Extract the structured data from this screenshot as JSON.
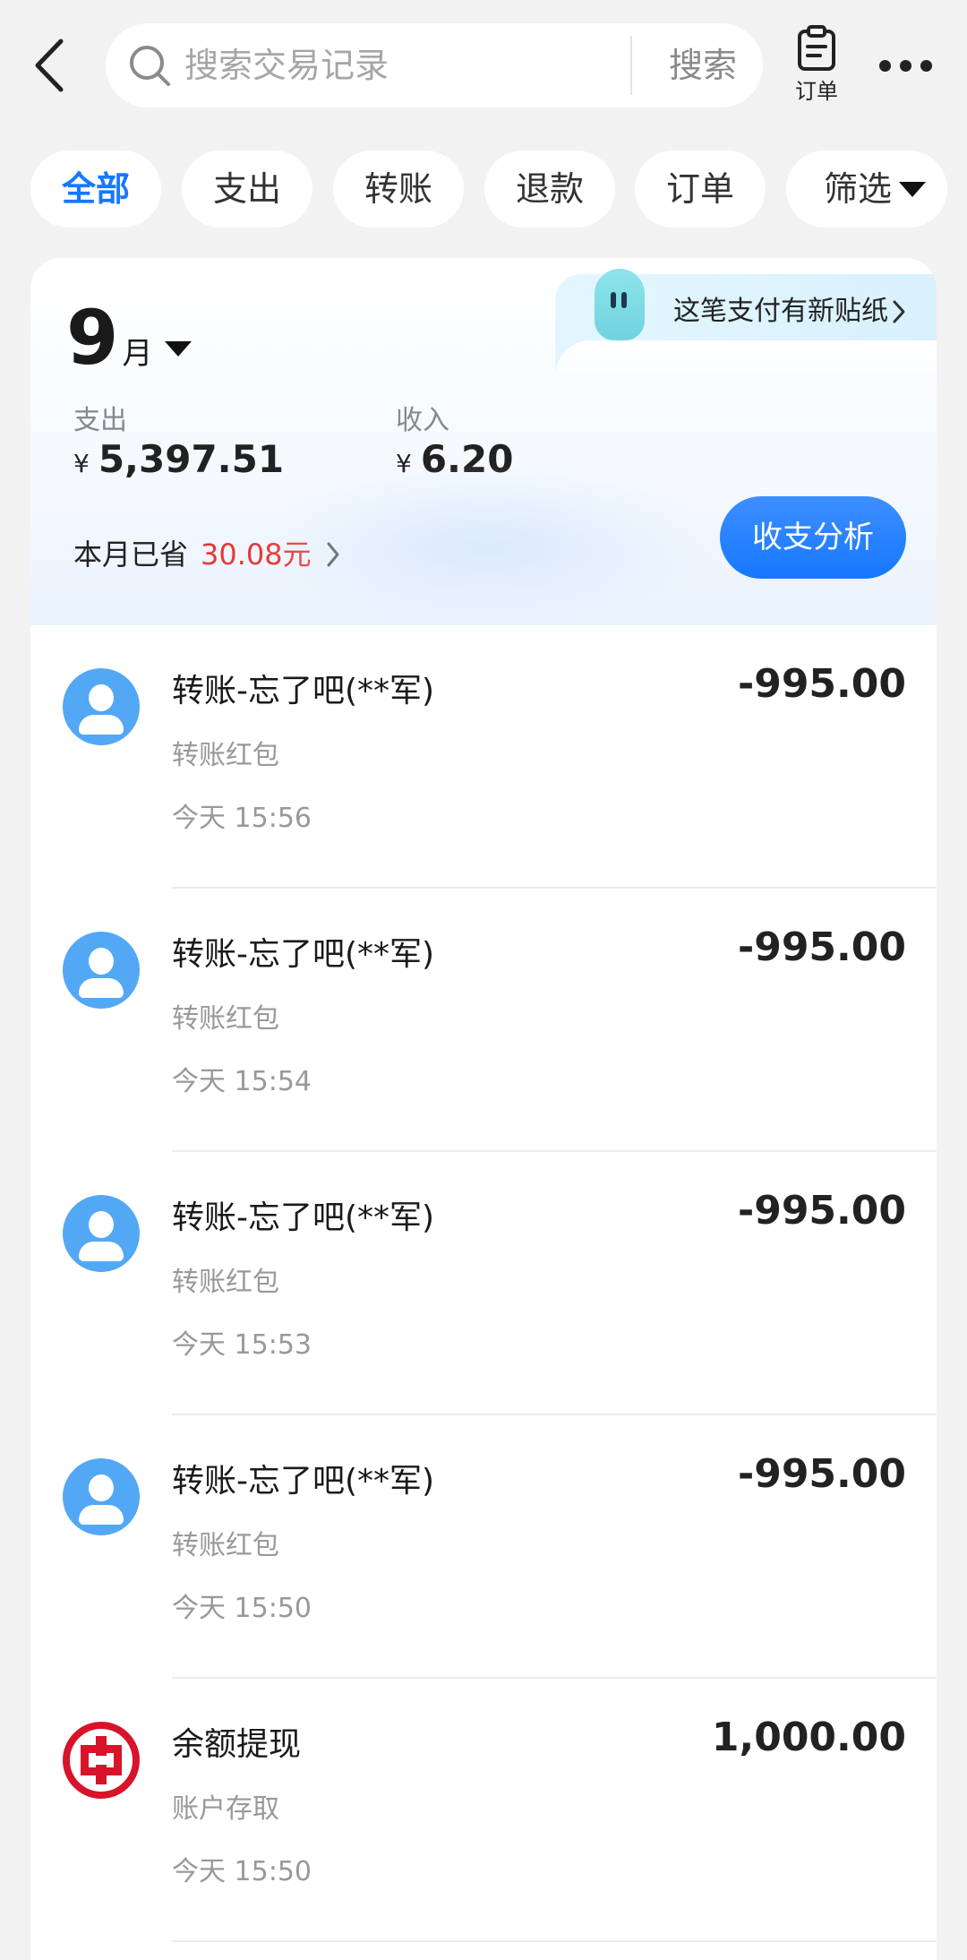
{
  "header": {
    "search_placeholder": "搜索交易记录",
    "search_button": "搜索",
    "order_label": "订单"
  },
  "filters": [
    "全部",
    "支出",
    "转账",
    "退款",
    "订单",
    "筛选"
  ],
  "sticker_banner": "这笔支付有新贴纸",
  "summary": {
    "month": "9",
    "month_unit": "月",
    "expense_label": "支出",
    "expense_currency": "¥",
    "expense_value": "5,397.51",
    "income_label": "收入",
    "income_currency": "¥",
    "income_value": "6.20",
    "saved_label": "本月已省",
    "saved_amount": "30.08元",
    "analysis_button": "收支分析"
  },
  "transactions": [
    {
      "icon": "person-avatar-icon",
      "title": "转账-忘了吧(**军)",
      "category": "转账红包",
      "time": "今天 15:56",
      "amount": "-995.00"
    },
    {
      "icon": "person-avatar-icon",
      "title": "转账-忘了吧(**军)",
      "category": "转账红包",
      "time": "今天 15:54",
      "amount": "-995.00"
    },
    {
      "icon": "person-avatar-icon",
      "title": "转账-忘了吧(**军)",
      "category": "转账红包",
      "time": "今天 15:53",
      "amount": "-995.00"
    },
    {
      "icon": "person-avatar-icon",
      "title": "转账-忘了吧(**军)",
      "category": "转账红包",
      "time": "今天 15:50",
      "amount": "-995.00"
    },
    {
      "icon": "icbc-bank-logo-icon",
      "title": "余额提现",
      "category": "账户存取",
      "time": "今天 15:50",
      "amount": "1,000.00"
    }
  ],
  "colors": {
    "accent": "#1677ff",
    "saved_red": "#e53935",
    "avatar_blue": "#52a8f5",
    "bank_red": "#d7142a"
  }
}
